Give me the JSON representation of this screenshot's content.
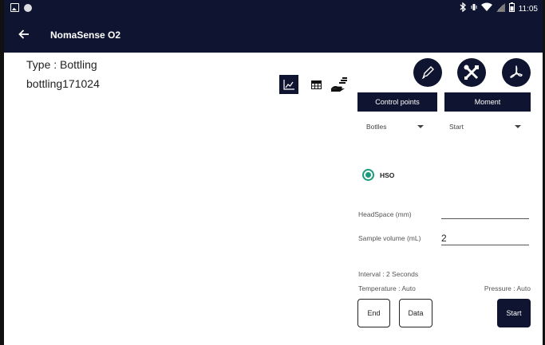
{
  "status_bar": {
    "time": "11:05",
    "icons": [
      "image-icon",
      "circle-icon",
      "bluetooth-icon",
      "vibrate-icon",
      "wifi-icon",
      "signal-icon",
      "battery-icon"
    ]
  },
  "toolbar": {
    "title": "NomaSense O2",
    "back_icon": "arrow-left-icon"
  },
  "sample": {
    "type_label": "Type : Bottling",
    "name": "bottling171024"
  },
  "view_buttons": [
    {
      "icon": "chart-icon",
      "active": true
    },
    {
      "icon": "table-icon",
      "active": false
    },
    {
      "icon": "export-icon",
      "active": false
    }
  ],
  "actions": {
    "edit_icon": "pencil-icon",
    "tools_icon": "tools-icon",
    "pdf_icon": "pdf-icon"
  },
  "tabs": {
    "control_points": "Control points",
    "moment": "Moment"
  },
  "selects": {
    "container": "Botlles",
    "moment": "Start"
  },
  "radio": {
    "label": "HSO",
    "selected": true
  },
  "fields": {
    "headspace_label": "HeadSpace (mm)",
    "headspace_value": "",
    "volume_label": "Sample volume (mL)",
    "volume_value": "2"
  },
  "info": {
    "interval": "Interval : 2 Seconds",
    "temperature": "Temperature : Auto",
    "pressure": "Pressure : Auto"
  },
  "buttons": {
    "end": "End",
    "data": "Data",
    "start": "Start"
  },
  "colors": {
    "primary": "#0f1530",
    "radio": "#1a9b7e"
  }
}
